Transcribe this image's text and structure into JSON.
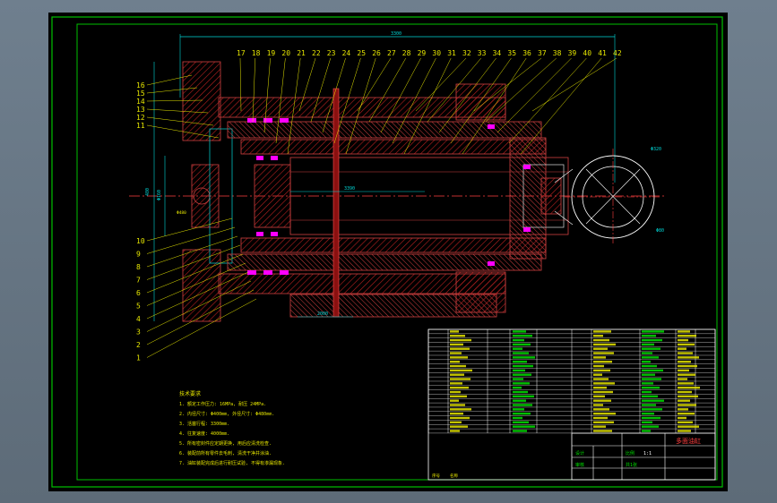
{
  "drawing": {
    "title_cn": "多面油缸",
    "dims": {
      "length_top": "3300",
      "stroke_mid": "3390",
      "bottom_small": "2000",
      "circle_dia": "Φ320",
      "circle_lower": "Φ80",
      "left_v1": "480",
      "left_v2": "Φ160",
      "left_v3": "Φ480"
    },
    "callouts_top": [
      "17",
      "18",
      "19",
      "20",
      "21",
      "22",
      "23",
      "24",
      "25",
      "26",
      "27",
      "28",
      "29",
      "30",
      "31",
      "32",
      "33",
      "34",
      "35",
      "36",
      "37",
      "38",
      "39",
      "40",
      "41",
      "42"
    ],
    "callouts_left_top": [
      "16",
      "15",
      "14",
      "13",
      "12",
      "11"
    ],
    "callouts_left_bottom": [
      "10",
      "9",
      "8",
      "7",
      "6",
      "5",
      "4",
      "3",
      "2",
      "1"
    ],
    "tech_requirements": {
      "heading": "技术要求",
      "lines": [
        "1. 额定工作压力: 16MPa, 耐压 24MPa.",
        "2. 内径尺寸: Φ400mm, 外径尺寸: Φ480mm.",
        "3. 活塞行程: 3300mm.",
        "4. 往复速度: 4000mm.",
        "5. 所有密封件应定期更换, 用后应清洗检查.",
        "6. 装配前所有零件去毛刺, 清洗干净并涂油.",
        "7. 油缸装配完成后进行耐压试验, 不得有渗漏现象."
      ]
    },
    "title_block": {
      "drawing_name": "多面油缸",
      "label_design": "设计",
      "label_check": "审核",
      "label_scale": "比例",
      "label_ratio": "1:1",
      "label_sheet": "共1张",
      "label_no": "序号",
      "label_name": "名称"
    },
    "colors": {
      "frame_green": "#00c000",
      "line_cyan": "#00d8d8",
      "part_red": "#d04040",
      "hatch_red": "#b82020",
      "text_yellow": "#e6e600",
      "seal_magenta": "#ff00ff",
      "text_green": "#00e000",
      "text_white": "#ffffff"
    }
  }
}
